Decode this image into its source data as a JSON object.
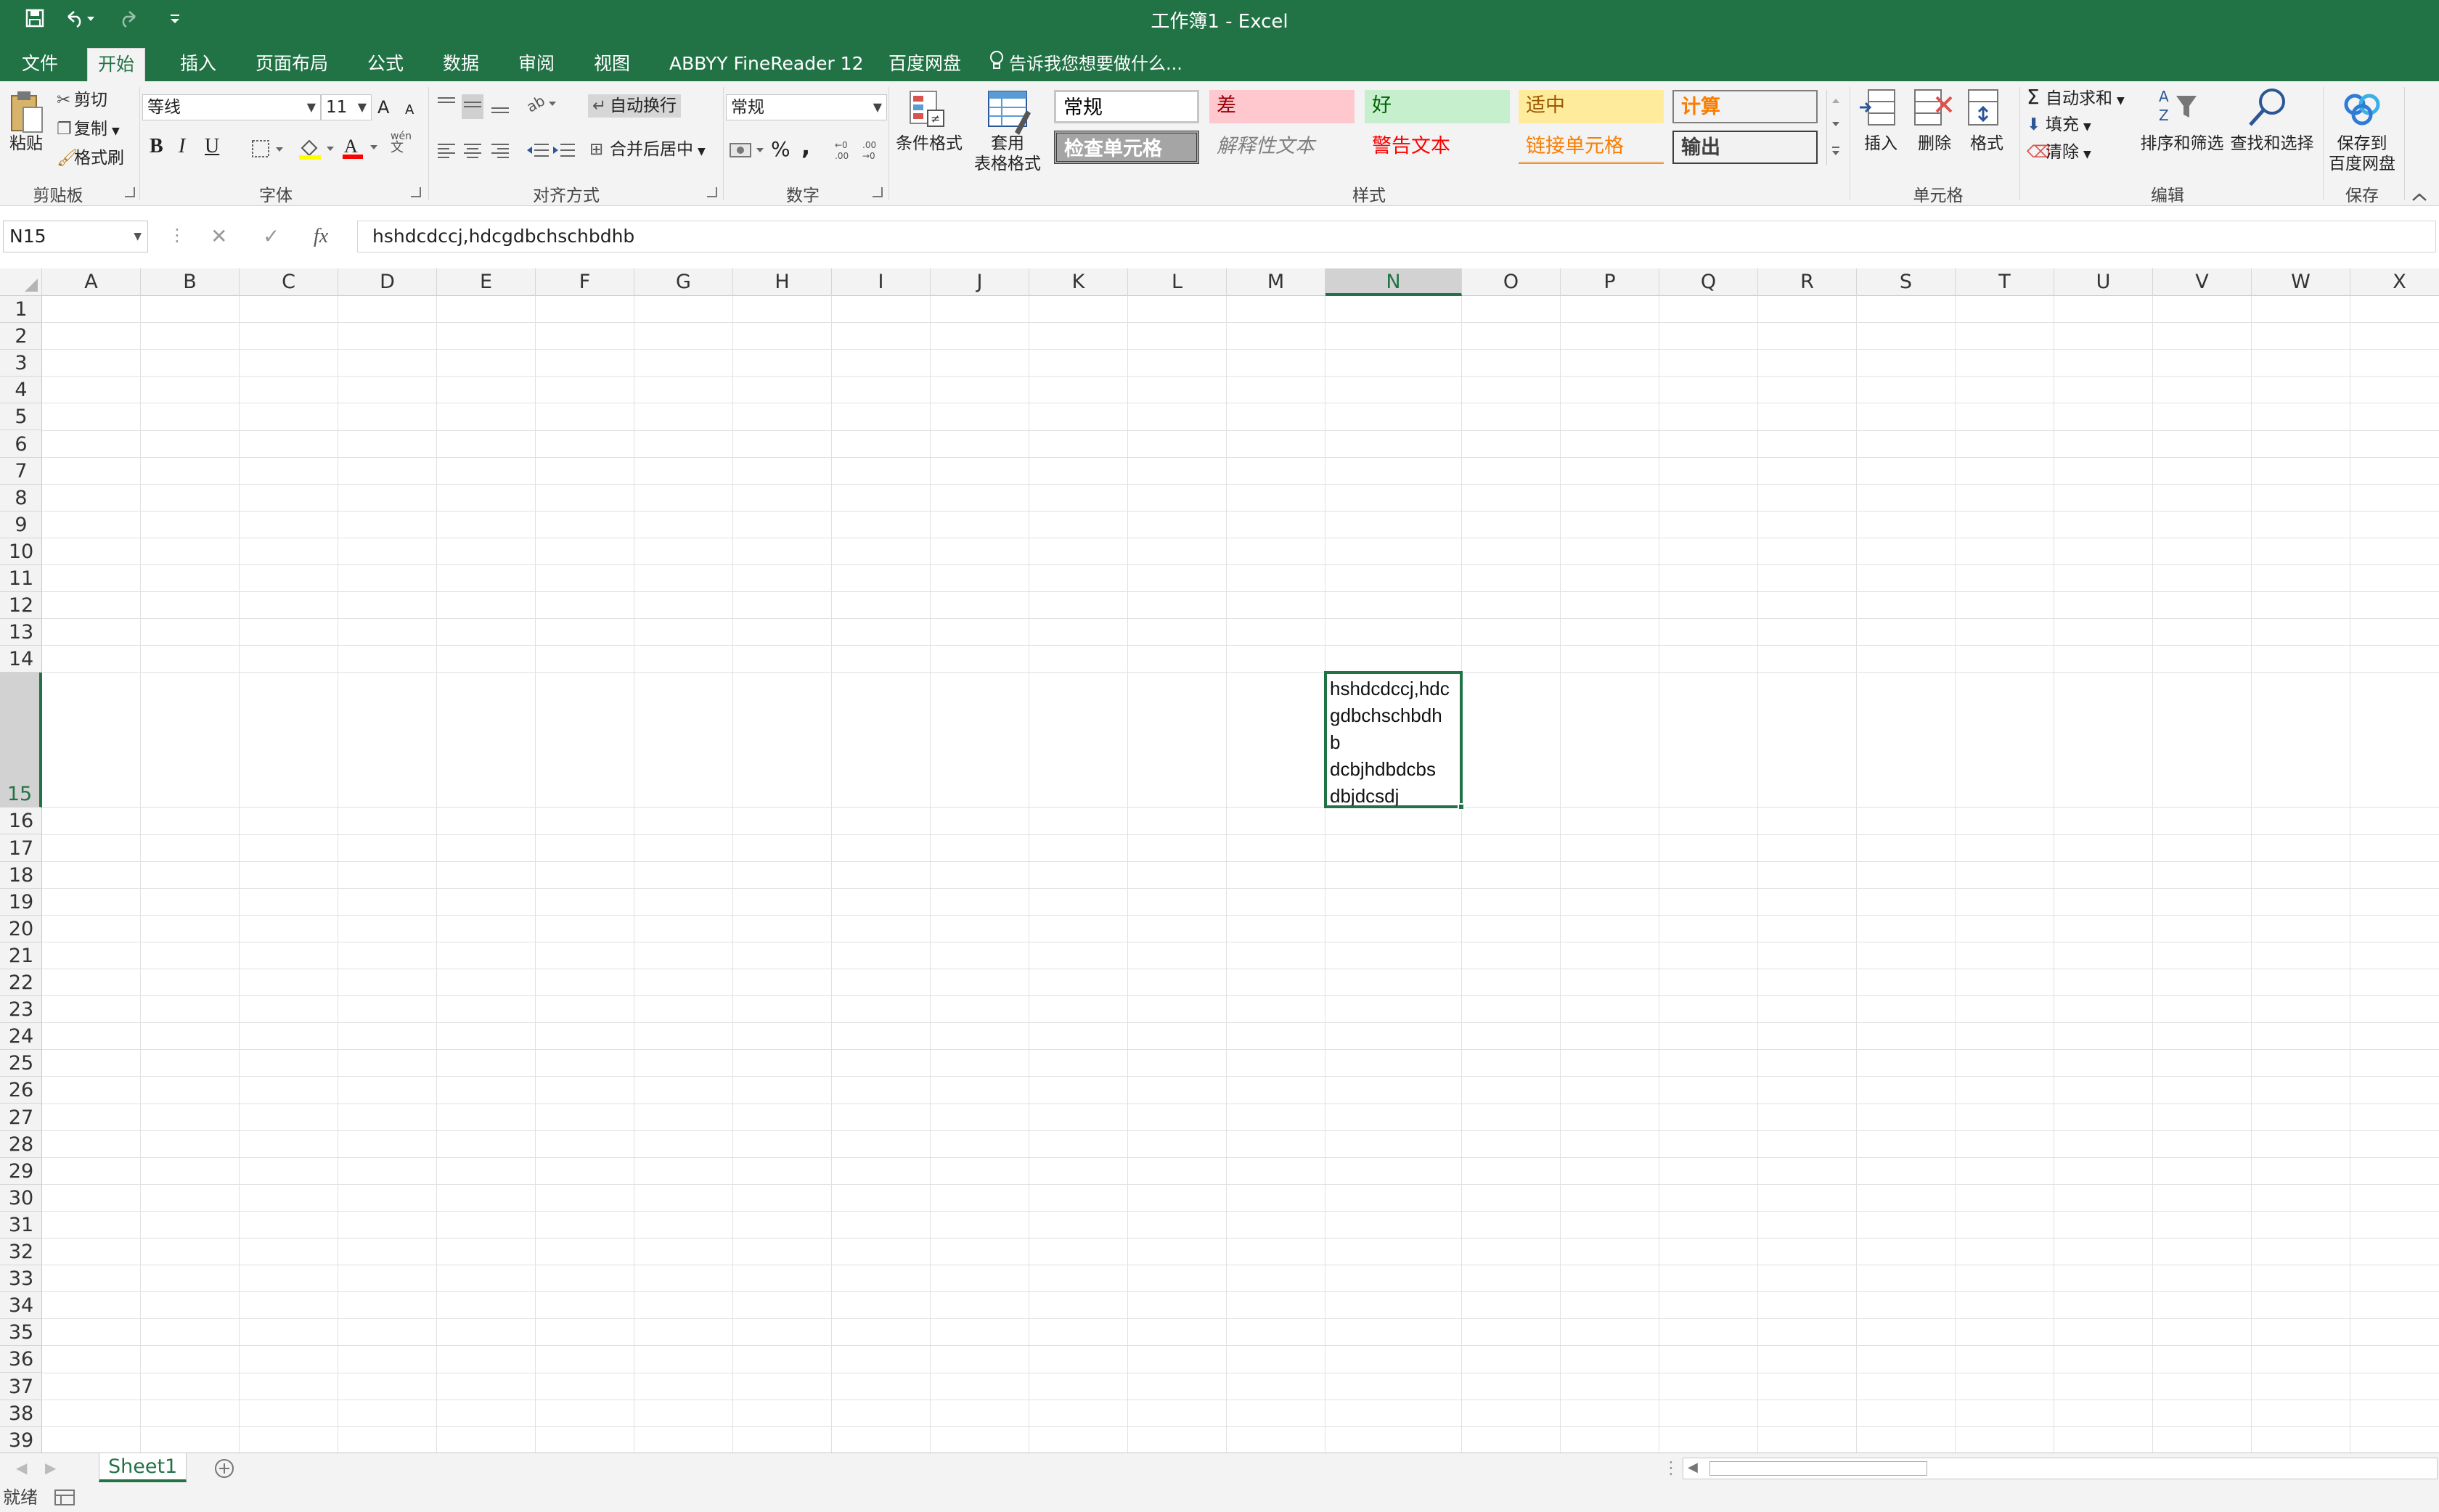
{
  "window": {
    "title": "工作簿1 - Excel",
    "accent_color": "#217346"
  },
  "quick_access": {
    "save_icon": "save-icon",
    "undo_icon": "undo-icon",
    "redo_icon": "redo-icon",
    "customize_icon": "customize-qat-icon"
  },
  "tabs": [
    {
      "label": "文件"
    },
    {
      "label": "开始",
      "active": true
    },
    {
      "label": "插入"
    },
    {
      "label": "页面布局"
    },
    {
      "label": "公式"
    },
    {
      "label": "数据"
    },
    {
      "label": "审阅"
    },
    {
      "label": "视图"
    },
    {
      "label": "ABBYY FineReader 12"
    },
    {
      "label": "百度网盘"
    }
  ],
  "tell_me": "告诉我您想要做什么...",
  "ribbon": {
    "clipboard": {
      "label": "剪贴板",
      "paste": "粘贴",
      "cut": "剪切",
      "copy": "复制",
      "format_painter": "格式刷"
    },
    "font": {
      "label": "字体",
      "font_name": "等线",
      "font_size": "11",
      "grow": "A",
      "shrink": "A",
      "bold": "B",
      "italic": "I",
      "underline": "U",
      "phonetic_top": "wén",
      "phonetic_bottom": "文"
    },
    "alignment": {
      "label": "对齐方式",
      "wrap_text": "自动换行",
      "merge_center": "合并后居中"
    },
    "number": {
      "label": "数字",
      "format": "常规",
      "percent": "%",
      "comma": ","
    },
    "styles": {
      "label": "样式",
      "conditional_formatting": "条件格式",
      "format_as_table_line1": "套用",
      "format_as_table_line2": "表格格式",
      "cells": [
        {
          "text": "常规",
          "bg": "#ffffff",
          "color": "#000000"
        },
        {
          "text": "差",
          "bg": "#ffc7ce",
          "color": "#9c0006"
        },
        {
          "text": "好",
          "bg": "#c6efce",
          "color": "#006100"
        },
        {
          "text": "适中",
          "bg": "#ffeb9c",
          "color": "#9c5700"
        },
        {
          "text": "计算",
          "bg": "#f2f2f2",
          "color": "#fa7d00"
        },
        {
          "text": "检查单元格",
          "bg": "#a5a5a5",
          "color": "#ffffff"
        },
        {
          "text": "解释性文本",
          "bg": "#f3f3f3",
          "color": "#7f7f7f"
        },
        {
          "text": "警告文本",
          "bg": "#f3f3f3",
          "color": "#ff0000"
        },
        {
          "text": "链接单元格",
          "bg": "#f3f3f3",
          "color": "#fa7d00"
        },
        {
          "text": "输出",
          "bg": "#f2f2f2",
          "color": "#3f3f3f"
        }
      ]
    },
    "cells_group": {
      "label": "单元格",
      "insert": "插入",
      "delete": "删除",
      "format": "格式"
    },
    "editing": {
      "label": "编辑",
      "autosum": "自动求和",
      "fill": "填充",
      "clear": "清除",
      "sort_filter": "排序和筛选",
      "find_select": "查找和选择"
    },
    "save": {
      "label": "保存",
      "line1": "保存到",
      "line2": "百度网盘"
    }
  },
  "formula_bar": {
    "name_box": "N15",
    "cancel": "✕",
    "enter": "✓",
    "fx": "fx",
    "formula": "hshdcdccj,hdcgdbchschbdhb"
  },
  "grid": {
    "columns": [
      "A",
      "B",
      "C",
      "D",
      "E",
      "F",
      "G",
      "H",
      "I",
      "J",
      "K",
      "L",
      "M",
      "N",
      "O",
      "P",
      "Q",
      "R",
      "S",
      "T",
      "U",
      "V",
      "W",
      "X"
    ],
    "selected_column": "N",
    "rows": [
      "1",
      "2",
      "3",
      "4",
      "5",
      "6",
      "7",
      "8",
      "9",
      "10",
      "11",
      "12",
      "13",
      "14",
      "15",
      "16",
      "17",
      "18",
      "19",
      "20",
      "21",
      "22",
      "23",
      "24",
      "25",
      "26",
      "27",
      "28",
      "29",
      "30",
      "31",
      "32",
      "33",
      "34",
      "35",
      "36",
      "37",
      "38",
      "39"
    ],
    "selected_row": "15",
    "active_cell": {
      "ref": "N15",
      "lines": [
        "hshdcdccj,hdc",
        "gdbchschbdh",
        "b",
        "dcbjhdbdcbs",
        "dbjdcsdj"
      ]
    }
  },
  "sheets": {
    "tabs": [
      "Sheet1"
    ],
    "add_icon": "add-sheet-icon"
  },
  "status": {
    "ready": "就绪"
  }
}
